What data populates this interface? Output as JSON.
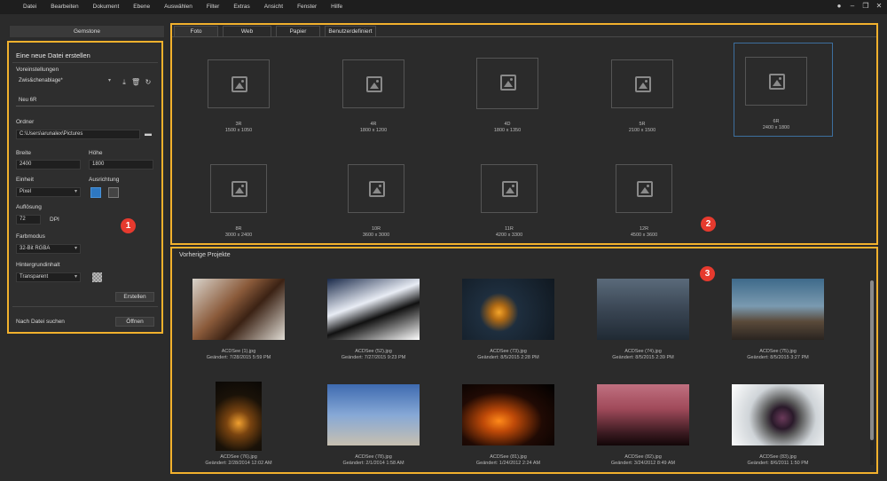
{
  "menu": [
    "Datei",
    "Bearbeiten",
    "Dokument",
    "Ebene",
    "Auswählen",
    "Filter",
    "Extras",
    "Ansicht",
    "Fenster",
    "Hilfe"
  ],
  "sidebar": {
    "tab_label": "Gemstone",
    "title": "Eine neue Datei erstellen",
    "presets_label": "Voreinstellungen",
    "preset_value": "Zwis&chenablage*",
    "name_value": "Neu 6R",
    "folder_label": "Ordner",
    "folder_value": "C:\\Users\\arunalex\\Pictures",
    "width_label": "Breite",
    "width_value": "2400",
    "height_label": "Höhe",
    "height_value": "1800",
    "unit_label": "Einheit",
    "unit_value": "Pixel",
    "orientation_label": "Ausrichtung",
    "resolution_label": "Auflösung",
    "resolution_value": "72",
    "resolution_unit": "DPI",
    "colormode_label": "Farbmodus",
    "colormode_value": "32-Bit RGBA",
    "background_label": "Hintergrundinhalt",
    "background_value": "Transparent",
    "create_button": "Erstellen",
    "search_label": "Nach Datei suchen",
    "open_button": "Öffnen",
    "badge": "1"
  },
  "templates": {
    "tabs": [
      "Foto",
      "Web",
      "Papier",
      "Benutzerdefiniert"
    ],
    "active_tab": "Foto",
    "badge": "2",
    "items": [
      {
        "name": "3R",
        "size": "1500 x 1050"
      },
      {
        "name": "4R",
        "size": "1800 x 1200"
      },
      {
        "name": "4D",
        "size": "1800 x 1350"
      },
      {
        "name": "5R",
        "size": "2100 x 1500"
      },
      {
        "name": "6R",
        "size": "2400 x 1800",
        "selected": true
      },
      {
        "name": "8R",
        "size": "3000 x 2400"
      },
      {
        "name": "10R",
        "size": "3600 x 3000"
      },
      {
        "name": "11R",
        "size": "4200 x 3300"
      },
      {
        "name": "12R",
        "size": "4500 x 3600"
      }
    ]
  },
  "projects": {
    "title": "Vorherige Projekte",
    "badge": "3",
    "items": [
      {
        "file": "ACDSee (1).jpg",
        "date": "Geändert: 7/28/2015 5:59 PM"
      },
      {
        "file": "ACDSee (52).jpg",
        "date": "Geändert: 7/27/2015 9:23 PM"
      },
      {
        "file": "ACDSee (73).jpg",
        "date": "Geändert: 8/5/2015 2:28 PM"
      },
      {
        "file": "ACDSee (74).jpg",
        "date": "Geändert: 8/5/2015 2:39 PM"
      },
      {
        "file": "ACDSee (75).jpg",
        "date": "Geändert: 8/5/2015 3:27 PM"
      },
      {
        "file": "ACDSee (76).jpg",
        "date": "Geändert: 2/28/2014 12:02 AM"
      },
      {
        "file": "ACDSee (78).jpg",
        "date": "Geändert: 2/1/2014 1:58 AM"
      },
      {
        "file": "ACDSee (81).jpg",
        "date": "Geändert: 1/24/2012 2:24 AM"
      },
      {
        "file": "ACDSee (82).jpg",
        "date": "Geändert: 3/24/2012 8:49 AM"
      },
      {
        "file": "ACDSee (83).jpg",
        "date": "Geändert: 8/6/2011 1:50 PM"
      }
    ]
  },
  "colors": {
    "accent": "#f2b12d",
    "badge": "#e63a2e",
    "selection": "#3d6f9e"
  }
}
